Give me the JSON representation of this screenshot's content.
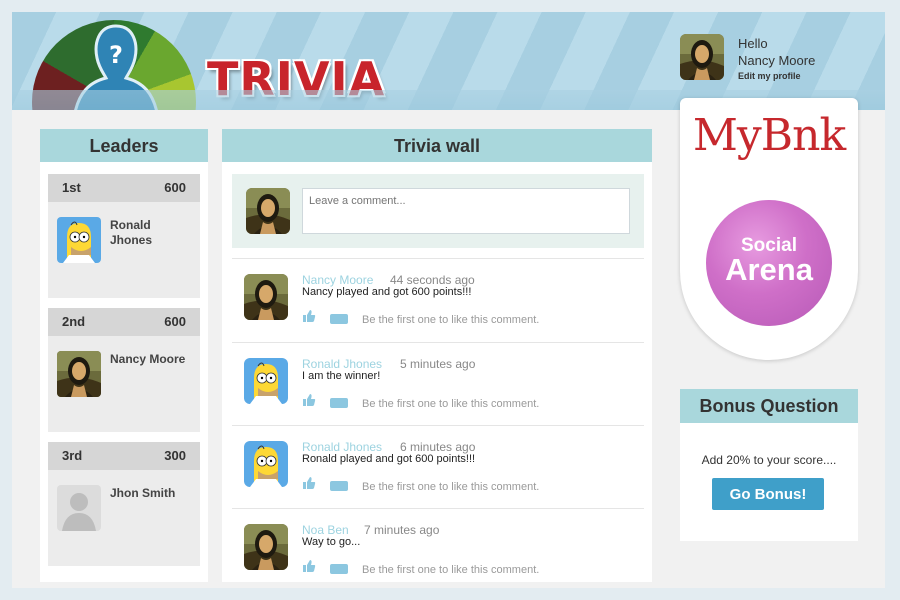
{
  "app": {
    "title": "TRIVIA"
  },
  "profile": {
    "greeting": "Hello",
    "name": "Nancy Moore",
    "edit_link": "Edit my profile"
  },
  "leaders": {
    "title": "Leaders",
    "items": [
      {
        "rank": "1st",
        "score": "600",
        "name": "Ronald Jhones",
        "avatar": "homer-avatar"
      },
      {
        "rank": "2nd",
        "score": "600",
        "name": "Nancy Moore",
        "avatar": "mona-lisa-avatar"
      },
      {
        "rank": "3rd",
        "score": "300",
        "name": "Jhon Smith",
        "avatar": "default-user-avatar"
      }
    ]
  },
  "wall": {
    "title": "Trivia wall",
    "comment_placeholder": "Leave a comment...",
    "posts": [
      {
        "author": "Nancy Moore",
        "time": "44 seconds ago",
        "text": "Nancy played and got 600 points!!!",
        "like_text": "Be the first one to like this comment.",
        "avatar": "mona-lisa-avatar"
      },
      {
        "author": "Ronald Jhones",
        "time": "5 minutes ago",
        "text": "I am the winner!",
        "like_text": "Be the first one to like this comment.",
        "avatar": "homer-avatar"
      },
      {
        "author": "Ronald Jhones",
        "time": "6 minutes ago",
        "text": "Ronald played and got 600 points!!!",
        "like_text": "Be the first one to like this comment.",
        "avatar": "homer-avatar"
      },
      {
        "author": "Noa Ben",
        "time": "7 minutes ago",
        "text": "Way to go...",
        "like_text": "Be the first one to like this comment.",
        "avatar": "mona-lisa-avatar"
      }
    ]
  },
  "sponsor": {
    "name": "MyBnk",
    "badge_line1": "Social",
    "badge_line2": "Arena"
  },
  "bonus": {
    "title": "Bonus Question",
    "text": "Add 20% to your score....",
    "button": "Go Bonus!"
  },
  "colors": {
    "accent_header": "#a9d7dc",
    "trivia_red": "#c8242b",
    "author_link": "#9dd3e0",
    "button_blue": "#3f9fc9"
  }
}
